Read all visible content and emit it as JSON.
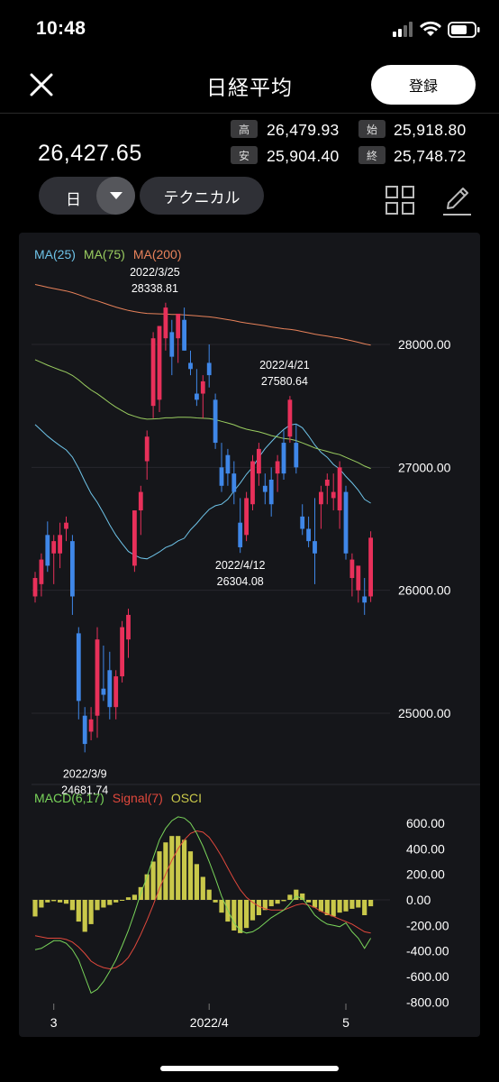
{
  "status_bar": {
    "time": "10:48"
  },
  "header": {
    "title": "日経平均",
    "register_label": "登録"
  },
  "quote": {
    "price": "26,427.65",
    "high_label": "高",
    "high": "26,479.93",
    "open_label": "始",
    "open": "25,918.80",
    "low_label": "安",
    "low": "25,904.40",
    "close_label": "終",
    "close": "25,748.72"
  },
  "toolbar": {
    "period": "日",
    "technical_label": "テクニカル"
  },
  "colors": {
    "up": "#e8305a",
    "down": "#3f87e8",
    "ma25": "#6ec3e8",
    "ma75": "#9acd60",
    "ma200": "#e8825a",
    "macd": "#79d45a",
    "signal": "#e0483c",
    "osci": "#c9c84a"
  },
  "chart_data": [
    {
      "type": "candlestick",
      "legend": [
        "MA(25)",
        "MA(75)",
        "MA(200)"
      ],
      "y_ticks": [
        "28000.00",
        "27000.00",
        "26000.00",
        "25000.00"
      ],
      "y_range": [
        24500,
        28800
      ],
      "x_ticks": [
        "3",
        "2022/4",
        "5"
      ],
      "annotations": [
        {
          "date": "2022/3/25",
          "value": "28338.81"
        },
        {
          "date": "2022/4/21",
          "value": "27580.64"
        },
        {
          "date": "2022/4/12",
          "value": "26304.08"
        },
        {
          "date": "2022/3/9",
          "value": "24681.74"
        }
      ],
      "candles": [
        {
          "o": 25950,
          "h": 26150,
          "l": 25900,
          "c": 26100
        },
        {
          "o": 26050,
          "h": 26300,
          "l": 25950,
          "c": 26250
        },
        {
          "o": 26450,
          "h": 26560,
          "l": 26150,
          "c": 26200
        },
        {
          "o": 26300,
          "h": 26450,
          "l": 26050,
          "c": 26400
        },
        {
          "o": 26300,
          "h": 26550,
          "l": 26180,
          "c": 26450
        },
        {
          "o": 26500,
          "h": 26600,
          "l": 26400,
          "c": 26550
        },
        {
          "o": 26400,
          "h": 26450,
          "l": 25800,
          "c": 25950
        },
        {
          "o": 25650,
          "h": 25700,
          "l": 24950,
          "c": 25100
        },
        {
          "o": 24980,
          "h": 25050,
          "l": 24681.74,
          "c": 24750
        },
        {
          "o": 24850,
          "h": 25050,
          "l": 24780,
          "c": 24950
        },
        {
          "o": 24980,
          "h": 25700,
          "l": 24800,
          "c": 25600
        },
        {
          "o": 25200,
          "h": 25550,
          "l": 25100,
          "c": 25150
        },
        {
          "o": 25350,
          "h": 25500,
          "l": 24950,
          "c": 25050
        },
        {
          "o": 25050,
          "h": 25350,
          "l": 24950,
          "c": 25300
        },
        {
          "o": 25300,
          "h": 25750,
          "l": 25250,
          "c": 25700
        },
        {
          "o": 25600,
          "h": 25850,
          "l": 25450,
          "c": 25800
        },
        {
          "o": 26200,
          "h": 26650,
          "l": 26150,
          "c": 26650
        },
        {
          "o": 26650,
          "h": 26850,
          "l": 26450,
          "c": 26800
        },
        {
          "o": 27050,
          "h": 27300,
          "l": 26900,
          "c": 27250
        },
        {
          "o": 27500,
          "h": 28100,
          "l": 27400,
          "c": 28050
        },
        {
          "o": 27550,
          "h": 28150,
          "l": 27450,
          "c": 28150
        },
        {
          "o": 28050,
          "h": 28338.81,
          "l": 27950,
          "c": 28300
        },
        {
          "o": 28100,
          "h": 28200,
          "l": 27750,
          "c": 27900
        },
        {
          "o": 28050,
          "h": 28200,
          "l": 27850,
          "c": 28250
        },
        {
          "o": 28200,
          "h": 28300,
          "l": 27950,
          "c": 27950
        },
        {
          "o": 27850,
          "h": 27950,
          "l": 27750,
          "c": 27800
        },
        {
          "o": 27600,
          "h": 27800,
          "l": 27500,
          "c": 27550
        },
        {
          "o": 27600,
          "h": 27750,
          "l": 27400,
          "c": 27700
        },
        {
          "o": 27850,
          "h": 28000,
          "l": 27650,
          "c": 27750
        },
        {
          "o": 27550,
          "h": 27600,
          "l": 27150,
          "c": 27200
        },
        {
          "o": 27000,
          "h": 27200,
          "l": 26800,
          "c": 26850
        },
        {
          "o": 27100,
          "h": 27150,
          "l": 26850,
          "c": 26950
        },
        {
          "o": 26950,
          "h": 27050,
          "l": 26700,
          "c": 26800
        },
        {
          "o": 26550,
          "h": 26750,
          "l": 26304.08,
          "c": 26350
        },
        {
          "o": 26450,
          "h": 26800,
          "l": 26400,
          "c": 26750
        },
        {
          "o": 26700,
          "h": 27100,
          "l": 26650,
          "c": 27050
        },
        {
          "o": 26950,
          "h": 27200,
          "l": 26850,
          "c": 27150
        },
        {
          "o": 26850,
          "h": 26950,
          "l": 26700,
          "c": 26800
        },
        {
          "o": 26900,
          "h": 27000,
          "l": 26600,
          "c": 26700
        },
        {
          "o": 26950,
          "h": 27100,
          "l": 26800,
          "c": 27050
        },
        {
          "o": 27200,
          "h": 27300,
          "l": 26900,
          "c": 26950
        },
        {
          "o": 27250,
          "h": 27580.64,
          "l": 27200,
          "c": 27550
        },
        {
          "o": 27200,
          "h": 27350,
          "l": 26950,
          "c": 27000
        },
        {
          "o": 26600,
          "h": 26700,
          "l": 26450,
          "c": 26500
        },
        {
          "o": 26500,
          "h": 26600,
          "l": 26350,
          "c": 26400
        },
        {
          "o": 26400,
          "h": 26750,
          "l": 26050,
          "c": 26300
        },
        {
          "o": 26700,
          "h": 26850,
          "l": 26500,
          "c": 26800
        },
        {
          "o": 26850,
          "h": 26950,
          "l": 26700,
          "c": 26900
        },
        {
          "o": 26750,
          "h": 26950,
          "l": 26650,
          "c": 26800
        },
        {
          "o": 26650,
          "h": 27050,
          "l": 26500,
          "c": 27000
        },
        {
          "o": 26800,
          "h": 26850,
          "l": 26250,
          "c": 26300
        },
        {
          "o": 26100,
          "h": 26300,
          "l": 25950,
          "c": 26250
        },
        {
          "o": 26000,
          "h": 26150,
          "l": 25900,
          "c": 26200
        },
        {
          "o": 25950,
          "h": 26100,
          "l": 25800,
          "c": 25900
        },
        {
          "o": 25950,
          "h": 26480,
          "l": 25904.4,
          "c": 26427.65
        }
      ]
    },
    {
      "type": "bar",
      "legend": [
        "MACD(6,17)",
        "Signal(7)",
        "OSCI"
      ],
      "y_ticks": [
        "600.00",
        "400.00",
        "200.00",
        "0.00",
        "-200.00",
        "-400.00",
        "-600.00",
        "-800.00"
      ],
      "y_range": [
        -800,
        650
      ],
      "osci": [
        -130,
        -60,
        -20,
        -10,
        -20,
        -30,
        -80,
        -170,
        -250,
        -190,
        -80,
        -60,
        -40,
        -20,
        0,
        20,
        40,
        100,
        200,
        300,
        380,
        450,
        500,
        500,
        470,
        380,
        280,
        180,
        80,
        -20,
        -100,
        -170,
        -240,
        -260,
        -220,
        -160,
        -120,
        -80,
        -50,
        -30,
        -10,
        40,
        80,
        50,
        -20,
        -60,
        -90,
        -120,
        -130,
        -100,
        -90,
        -70,
        -60,
        -120,
        -50
      ],
      "macd": [
        -390,
        -380,
        -350,
        -320,
        -320,
        -340,
        -390,
        -470,
        -600,
        -730,
        -700,
        -640,
        -560,
        -470,
        -360,
        -240,
        -100,
        50,
        180,
        330,
        470,
        560,
        620,
        650,
        640,
        600,
        520,
        420,
        300,
        170,
        30,
        -80,
        -180,
        -240,
        -260,
        -250,
        -220,
        -180,
        -140,
        -110,
        -80,
        -30,
        30,
        10,
        -50,
        -120,
        -160,
        -190,
        -200,
        -210,
        -180,
        -250,
        -300,
        -380,
        -300
      ],
      "signal": [
        -280,
        -290,
        -300,
        -300,
        -300,
        -310,
        -330,
        -370,
        -420,
        -480,
        -510,
        -530,
        -540,
        -530,
        -500,
        -450,
        -370,
        -270,
        -160,
        -40,
        90,
        200,
        310,
        400,
        470,
        520,
        540,
        530,
        490,
        420,
        340,
        250,
        160,
        80,
        20,
        -20,
        -50,
        -70,
        -80,
        -80,
        -80,
        -60,
        -40,
        -30,
        -40,
        -60,
        -90,
        -110,
        -130,
        -150,
        -170,
        -190,
        -220,
        -250,
        -260
      ]
    }
  ]
}
